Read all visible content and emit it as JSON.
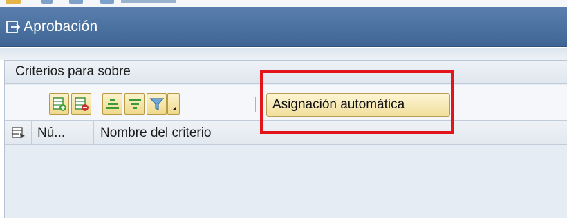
{
  "window": {
    "title": "Aprobación"
  },
  "panel": {
    "header": "Criterios para sobre"
  },
  "toolbar": {
    "buttons": [
      {
        "icon": "insert-row-icon"
      },
      {
        "icon": "delete-row-icon"
      },
      {
        "icon": "align-center-icon"
      },
      {
        "icon": "sort-icon"
      },
      {
        "icon": "filter-icon"
      },
      {
        "icon": "dropdown-icon"
      }
    ],
    "auto_assign_label": "Asignación automática"
  },
  "table": {
    "columns": [
      "Nú...",
      "Nombre del criterio"
    ],
    "rows": []
  },
  "colors": {
    "title_bar": "#3e6594",
    "button_fill": "#f1df9d",
    "highlight": "#e3151b",
    "panel_bg": "#e7edf4"
  }
}
